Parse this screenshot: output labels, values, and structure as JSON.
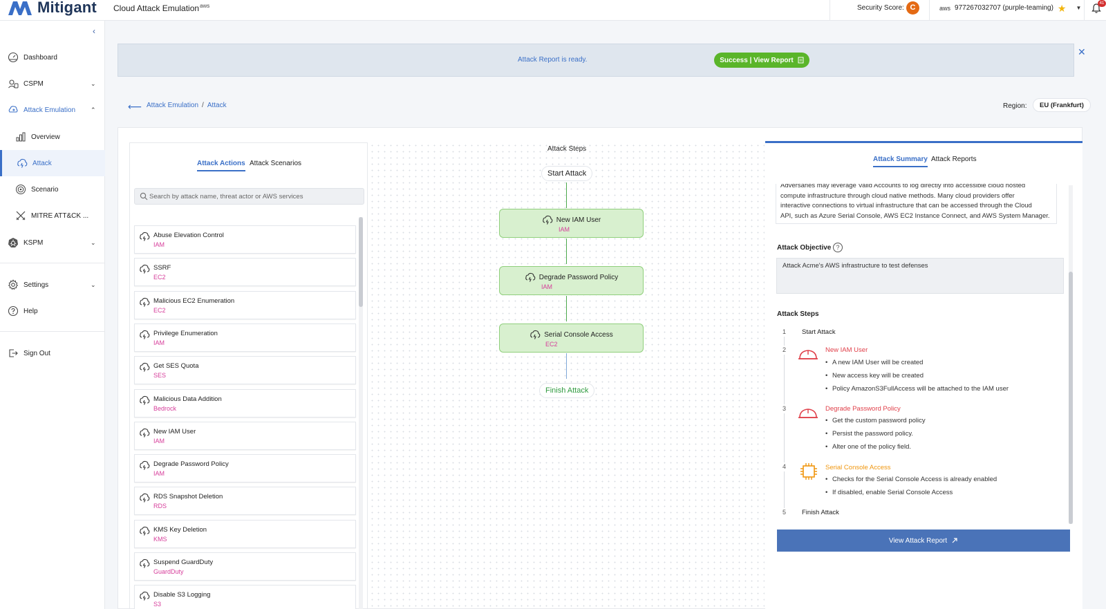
{
  "header": {
    "logo_text": "Mitigant",
    "app_title": "Cloud Attack Emulation",
    "aws_label": "aws",
    "security_score_label": "Security Score:",
    "security_score_grade": "C",
    "account_aws": "aws",
    "account": "977267032707 (purple-teaming)",
    "notification_count": "41"
  },
  "sidebar": {
    "items": [
      {
        "label": "Dashboard"
      },
      {
        "label": "CSPM"
      },
      {
        "label": "Attack Emulation"
      },
      {
        "label": "Overview"
      },
      {
        "label": "Attack"
      },
      {
        "label": "Scenario"
      },
      {
        "label": "MITRE ATT&CK ..."
      },
      {
        "label": "KSPM"
      },
      {
        "label": "Settings"
      },
      {
        "label": "Help"
      },
      {
        "label": "Sign Out"
      }
    ]
  },
  "banner": {
    "text": "Attack Report is ready.",
    "button": "Success | View Report"
  },
  "breadcrumb": {
    "parent": "Attack Emulation",
    "separator": "/",
    "current": "Attack"
  },
  "region": {
    "label": "Region:",
    "value": "EU (Frankfurt)"
  },
  "left_panel": {
    "tabs": [
      "Attack Actions",
      "Attack Scenarios"
    ],
    "search_placeholder": "Search by attack name, threat actor or AWS services",
    "actions": [
      {
        "name": "Abuse Elevation Control",
        "service": "IAM"
      },
      {
        "name": "SSRF",
        "service": "EC2"
      },
      {
        "name": "Malicious EC2 Enumeration",
        "service": "EC2"
      },
      {
        "name": "Privilege Enumeration",
        "service": "IAM"
      },
      {
        "name": "Get SES Quota",
        "service": "SES"
      },
      {
        "name": "Malicious Data Addition",
        "service": "Bedrock"
      },
      {
        "name": "New IAM User",
        "service": "IAM"
      },
      {
        "name": "Degrade Password Policy",
        "service": "IAM"
      },
      {
        "name": "RDS Snapshot Deletion",
        "service": "RDS"
      },
      {
        "name": "KMS Key Deletion",
        "service": "KMS"
      },
      {
        "name": "Suspend GuardDuty",
        "service": "GuardDuty"
      },
      {
        "name": "Disable S3 Logging",
        "service": "S3"
      }
    ]
  },
  "canvas": {
    "title": "Attack Steps",
    "start": "Start Attack",
    "finish": "Finish Attack",
    "steps": [
      {
        "name": "New IAM User",
        "service": "IAM"
      },
      {
        "name": "Degrade Password Policy",
        "service": "IAM"
      },
      {
        "name": "Serial Console Access",
        "service": "EC2"
      }
    ]
  },
  "right_panel": {
    "tabs": [
      "Attack Summary",
      "Attack Reports"
    ],
    "description_lines": [
      "Adversaries may leverage Valid Accounts to log directly into accessible cloud hosted",
      "compute infrastructure through cloud native methods. Many cloud providers offer",
      "interactive connections to virtual infrastructure that can be accessed through the Cloud",
      "API, such as Azure Serial Console, AWS EC2 Instance Connect, and AWS System Manager."
    ],
    "objective_label": "Attack Objective",
    "objective_help": "?",
    "objective_value": "Attack Acme's AWS infrastructure to test defenses",
    "steps_label": "Attack Steps",
    "steps": [
      {
        "num": "1",
        "title": "Start Attack",
        "bullets": []
      },
      {
        "num": "2",
        "title": "New IAM User",
        "bullets": [
          "A new IAM User will be created",
          "New access key will be created",
          "Policy AmazonS3FullAccess will be attached to the IAM user"
        ]
      },
      {
        "num": "3",
        "title": "Degrade Password Policy",
        "bullets": [
          "Get the custom password policy",
          "Persist the password policy.",
          "Alter one of the policy field."
        ]
      },
      {
        "num": "4",
        "title": "Serial Console Access",
        "bullets": [
          "Checks for the Serial Console Access is already enabled",
          "If disabled, enable Serial Console Access"
        ]
      },
      {
        "num": "5",
        "title": "Finish Attack",
        "bullets": []
      }
    ],
    "view_report_button": "View Attack Report"
  },
  "colors": {
    "accent": "#3a6fc7",
    "service_pink": "#d63c9a",
    "success_green": "#5ab52a",
    "node_fill": "#d8f0cf",
    "iam_red": "#e0404a",
    "ec2_orange": "#f0960e"
  }
}
